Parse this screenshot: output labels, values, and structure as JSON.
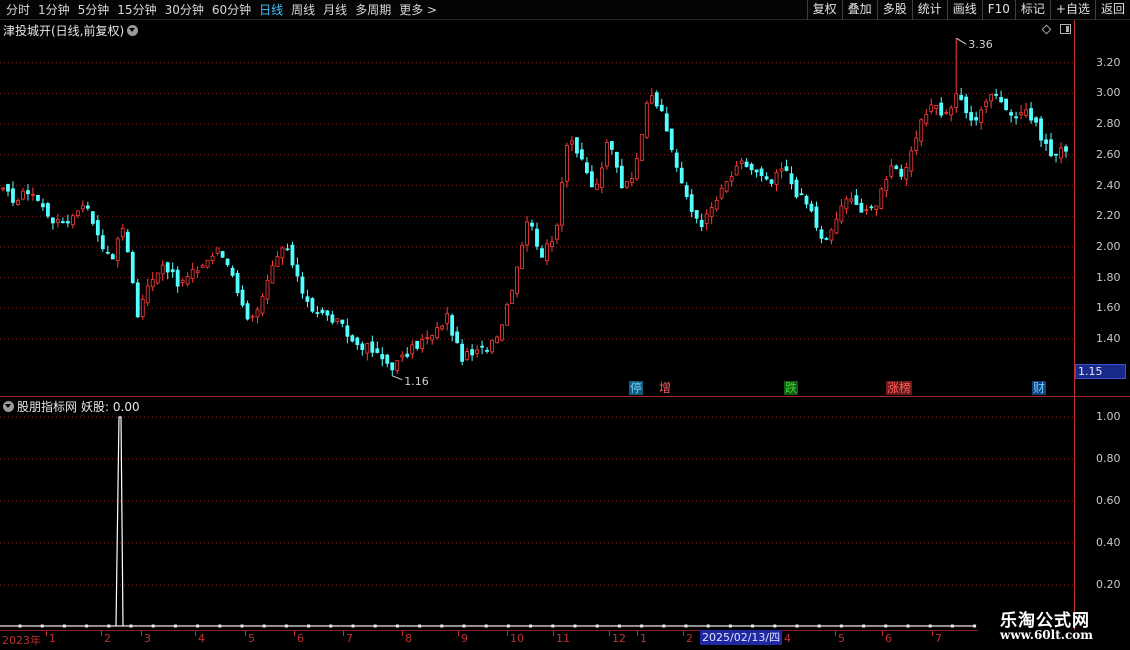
{
  "toolbar": {
    "periods": [
      "分时",
      "1分钟",
      "5分钟",
      "15分钟",
      "30分钟",
      "60分钟",
      "日线",
      "周线",
      "月线",
      "多周期",
      "更多 >"
    ],
    "active_period": "日线",
    "buttons": [
      "复权",
      "叠加",
      "多股",
      "统计",
      "画线",
      "F10",
      "标记",
      "+自选",
      "返回"
    ]
  },
  "price_panel": {
    "title": "津投城开(日线,前复权)",
    "high_label": "3.36",
    "low_label": "1.16",
    "current_price": "1.15",
    "events": [
      {
        "label": "停",
        "color": "#66d0ff",
        "bg": "#155a7a"
      },
      {
        "label": "增",
        "color": "#ff5a5a",
        "bg": ""
      },
      {
        "label": "跌",
        "color": "#3cd23c",
        "bg": "#145a14"
      },
      {
        "label": "涨榜",
        "color": "#ff5a5a",
        "bg": "#6a1a1a"
      },
      {
        "label": "财",
        "color": "#66d0ff",
        "bg": "#15407a"
      }
    ]
  },
  "indicator_panel": {
    "name": "股朋指标网",
    "value": "妖股: 0.00"
  },
  "date_axis": {
    "labels": [
      "2023年",
      "1",
      "2",
      "3",
      "4",
      "5",
      "6",
      "7",
      "8",
      "9",
      "10",
      "11",
      "12",
      "1",
      "2",
      "4",
      "5",
      "6",
      "7"
    ],
    "cursor_date": "2025/02/13/四"
  },
  "watermark": {
    "title": "乐淘公式网",
    "url": "www.60lt.com"
  },
  "colors": {
    "up": "#ff3c3c",
    "down": "#54ffff",
    "grid": "#8a1a1a",
    "axis": "#c03030"
  },
  "chart_data": [
    {
      "type": "candlestick",
      "title": "津投城开(日线,前复权)",
      "y_ticks": [
        1.4,
        1.6,
        1.8,
        2.0,
        2.2,
        2.4,
        2.6,
        2.8,
        3.0,
        3.2
      ],
      "ylim": [
        1.1,
        3.4
      ],
      "x_months": [
        "1",
        "2",
        "3",
        "4",
        "5",
        "6",
        "7",
        "8",
        "9",
        "10",
        "11",
        "12",
        "1",
        "2",
        "4",
        "5",
        "6",
        "7"
      ],
      "close_path": [
        2.36,
        2.3,
        2.38,
        2.25,
        2.15,
        2.18,
        2.3,
        2.1,
        1.9,
        2.15,
        1.55,
        1.8,
        1.9,
        1.75,
        1.82,
        1.9,
        1.98,
        1.85,
        1.55,
        1.58,
        1.85,
        2.02,
        1.75,
        1.6,
        1.55,
        1.5,
        1.38,
        1.35,
        1.28,
        1.22,
        1.3,
        1.38,
        1.42,
        1.55,
        1.28,
        1.3,
        1.35,
        1.48,
        1.8,
        2.2,
        1.95,
        2.05,
        2.75,
        2.55,
        2.35,
        2.7,
        2.4,
        2.5,
        3.05,
        2.85,
        2.55,
        2.25,
        2.15,
        2.3,
        2.45,
        2.55,
        2.48,
        2.4,
        2.52,
        2.35,
        2.25,
        2.0,
        2.2,
        2.35,
        2.2,
        2.3,
        2.55,
        2.45,
        2.75,
        2.95,
        2.85,
        3.0,
        2.8,
        2.95,
        3.0,
        2.85,
        2.9,
        2.75,
        2.58,
        2.65
      ],
      "high": 3.36,
      "low": 1.16,
      "last": 1.15
    },
    {
      "type": "line",
      "name": "妖股",
      "y_ticks": [
        0.2,
        0.4,
        0.6,
        0.8,
        1.0
      ],
      "ylim": [
        0.0,
        1.0
      ],
      "spike_positions": [
        0.04
      ],
      "series": [
        {
          "name": "妖股",
          "values": [
            0,
            0,
            0,
            1,
            0,
            0
          ]
        }
      ],
      "current": 0.0
    }
  ]
}
